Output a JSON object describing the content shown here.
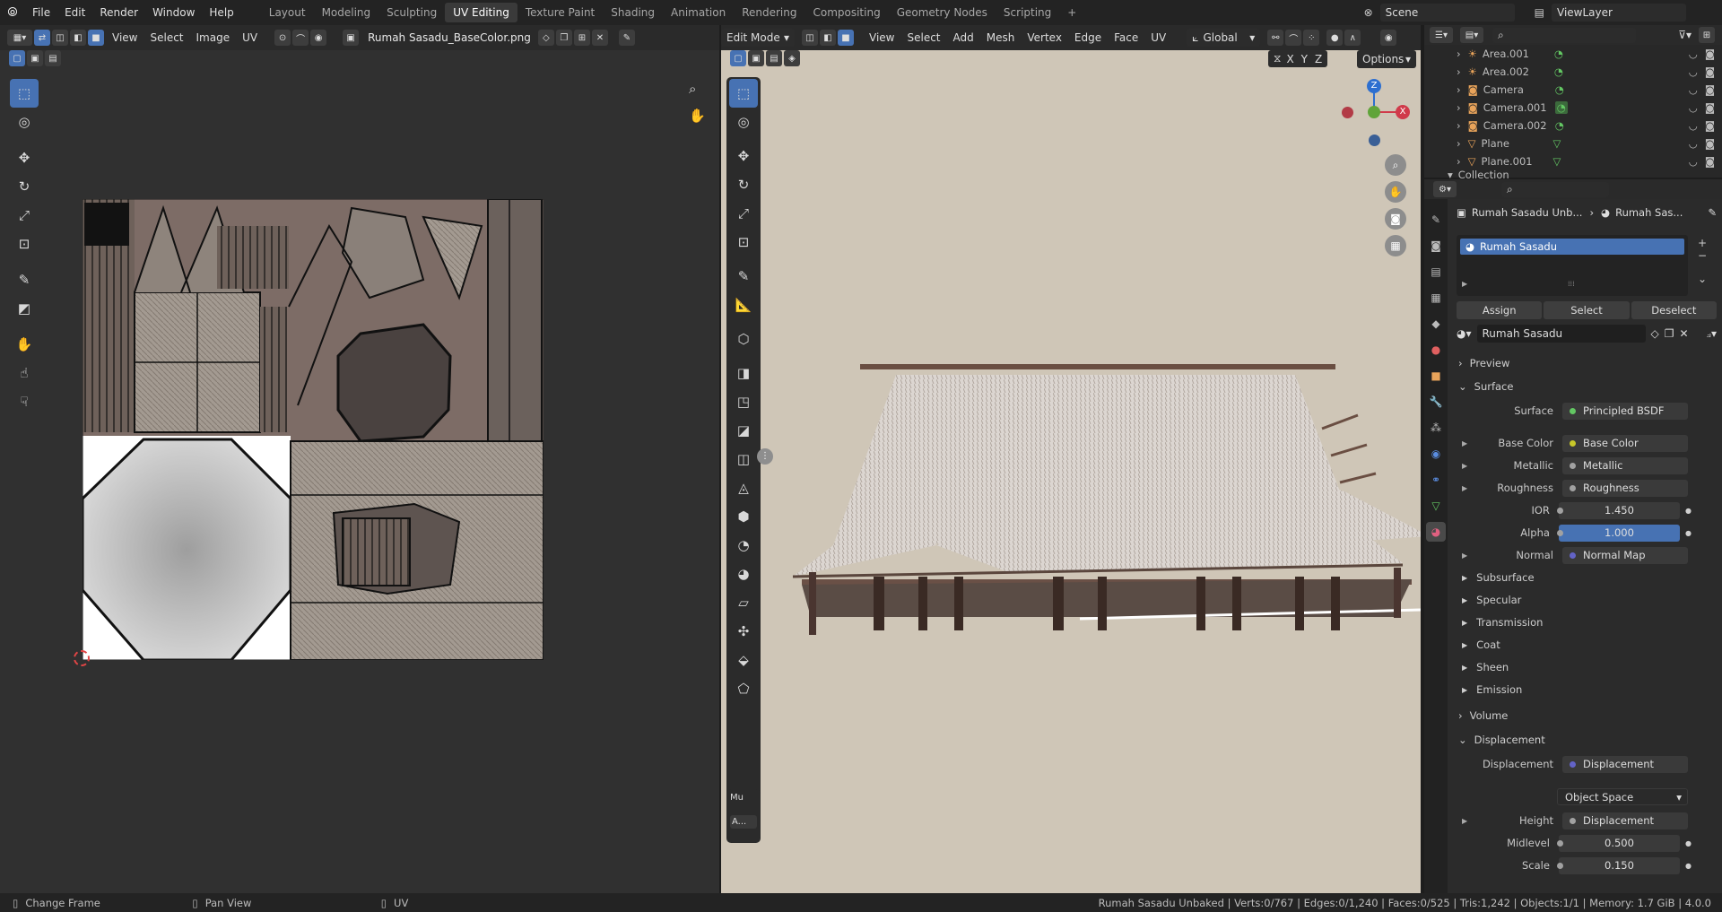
{
  "menus": [
    "File",
    "Edit",
    "Render",
    "Window",
    "Help"
  ],
  "workspaces": [
    "Layout",
    "Modeling",
    "Sculpting",
    "UV Editing",
    "Texture Paint",
    "Shading",
    "Animation",
    "Rendering",
    "Compositing",
    "Geometry Nodes",
    "Scripting",
    "+"
  ],
  "active_workspace": "UV Editing",
  "scene": "Scene",
  "view_layer": "ViewLayer",
  "uv_editor": {
    "menus": [
      "View",
      "Select",
      "Image",
      "UV"
    ],
    "image_name": "Rumah Sasadu_BaseColor.png"
  },
  "viewport": {
    "mode": "Edit Mode",
    "menus": [
      "View",
      "Select",
      "Add",
      "Mesh",
      "Vertex",
      "Edge",
      "Face",
      "UV"
    ],
    "orientation": "Global",
    "mirror_axes": [
      "X",
      "Y",
      "Z"
    ],
    "options_label": "Options",
    "gizmo": {
      "z": "Z",
      "x": "X"
    },
    "panel_label": "Mu",
    "panel_btn": "A..."
  },
  "outliner": {
    "items": [
      "Area.001",
      "Area.002",
      "Camera",
      "Camera.001",
      "Camera.002",
      "Plane",
      "Plane.001"
    ],
    "collection": "Collection"
  },
  "properties": {
    "breadcrumb_object": "Rumah Sasadu Unb...",
    "breadcrumb_material": "Rumah Sas...",
    "material_slot": "Rumah Sasadu",
    "buttons": {
      "assign": "Assign",
      "select": "Select",
      "deselect": "Deselect"
    },
    "material_name": "Rumah Sasadu",
    "sections": {
      "preview": "Preview",
      "surface": "Surface",
      "volume": "Volume",
      "displacement": "Displacement"
    },
    "surface_rows": [
      {
        "label": "Surface",
        "value": "Principled BSDF",
        "dot": "#63c763"
      },
      {
        "label": "Base Color",
        "value": "Base Color",
        "dot": "#c7c729"
      },
      {
        "label": "Metallic",
        "value": "Metallic",
        "dot": "#a1a1a1"
      },
      {
        "label": "Roughness",
        "value": "Roughness",
        "dot": "#a1a1a1"
      },
      {
        "label": "IOR",
        "value": "1.450",
        "dot": "#a1a1a1"
      },
      {
        "label": "Alpha",
        "value": "1.000",
        "dot": "#a1a1a1"
      },
      {
        "label": "Normal",
        "value": "Normal Map",
        "dot": "#6363c7"
      }
    ],
    "subpanels": [
      "Subsurface",
      "Specular",
      "Transmission",
      "Coat",
      "Sheen",
      "Emission"
    ],
    "displacement_rows": [
      {
        "label": "Displacement",
        "value": "Displacement",
        "dot": "#6363c7"
      }
    ],
    "space": "Object Space",
    "disp_rows2": [
      {
        "label": "Height",
        "value": "Displacement",
        "dot": "#a1a1a1"
      },
      {
        "label": "Midlevel",
        "value": "0.500",
        "dot": "#a1a1a1"
      },
      {
        "label": "Scale",
        "value": "0.150",
        "dot": "#a1a1a1"
      }
    ]
  },
  "status": {
    "left": "Change Frame",
    "mid": "Pan View",
    "right": "UV",
    "stats": "Rumah Sasadu Unbaked | Verts:0/767 | Edges:0/1,240 | Faces:0/525 | Tris:1,242 | Objects:1/1 | Memory: 1.7 GiB | 4.0.0"
  },
  "colors": {
    "accent": "#4772b3",
    "viewport_bg": "#cfc6b7",
    "uv_bg": "#303030"
  }
}
